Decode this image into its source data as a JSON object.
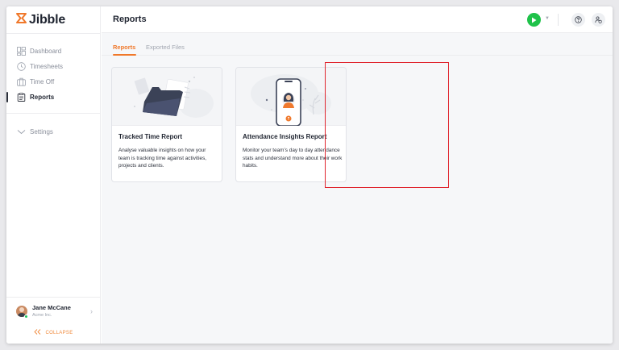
{
  "app": {
    "name": "Jibble",
    "accent": "#f0782a",
    "highlight": "#e0262f"
  },
  "sidebar": {
    "items": [
      {
        "label": "Dashboard",
        "icon": "dashboard-icon",
        "active": false
      },
      {
        "label": "Timesheets",
        "icon": "clock-icon",
        "active": false
      },
      {
        "label": "Time Off",
        "icon": "suitcase-icon",
        "active": false
      },
      {
        "label": "Reports",
        "icon": "clipboard-icon",
        "active": true
      }
    ],
    "settings_label": "Settings",
    "user": {
      "name": "Jane McCane",
      "org": "Acme Inc."
    },
    "collapse_label": "COLLAPSE"
  },
  "header": {
    "title": "Reports"
  },
  "tabs": [
    {
      "label": "Reports",
      "active": true
    },
    {
      "label": "Exported Files",
      "active": false
    }
  ],
  "cards": [
    {
      "title": "Tracked Time Report",
      "description": "Analyse valuable insights on how your team is tracking time against activities, projects and clients."
    },
    {
      "title": "Attendance Insights Report",
      "description": "Monitor your team’s day to day attendance stats and understand more about their work habits."
    }
  ]
}
